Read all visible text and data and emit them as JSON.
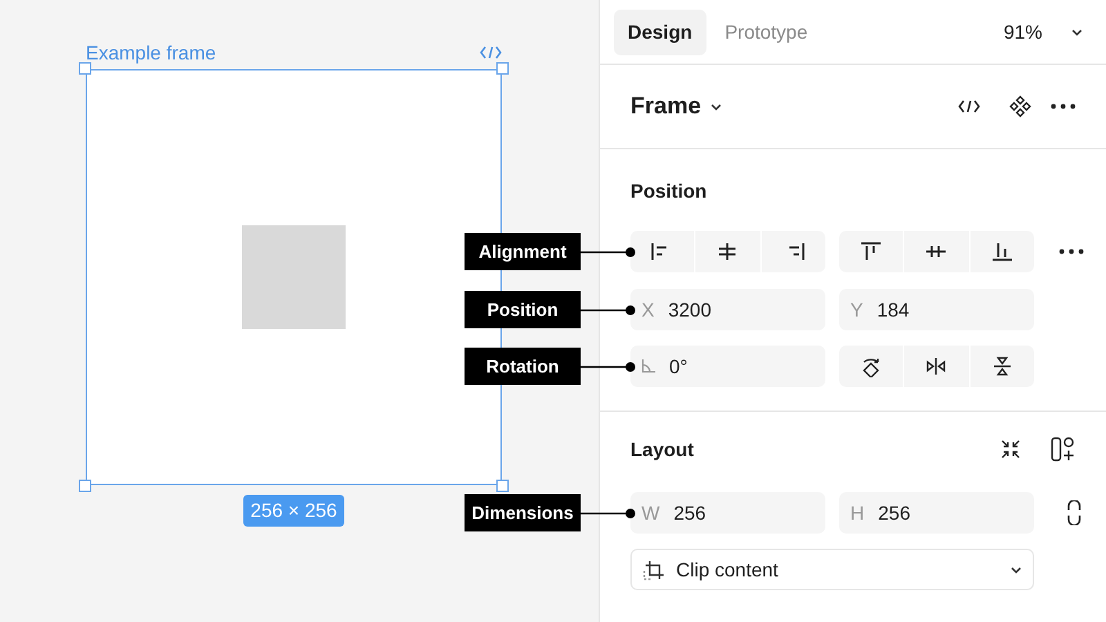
{
  "canvas": {
    "frame_label": "Example frame",
    "frame_size": "256 × 256"
  },
  "panel": {
    "tabs": [
      {
        "label": "Design",
        "selected": true
      },
      {
        "label": "Prototype",
        "selected": false
      }
    ],
    "zoom": "91%",
    "layer": "Frame",
    "position": {
      "title": "Position",
      "x": {
        "label": "X",
        "value": "3200"
      },
      "y": {
        "label": "Y",
        "value": "184"
      },
      "rotation": "0°"
    },
    "layout": {
      "title": "Layout",
      "w": {
        "label": "W",
        "value": "256"
      },
      "h": {
        "label": "H",
        "value": "256"
      },
      "clip": "Clip content"
    }
  },
  "annotations": {
    "alignment": "Alignment",
    "position": "Position",
    "rotation": "Rotation",
    "dimensions": "Dimensions"
  }
}
